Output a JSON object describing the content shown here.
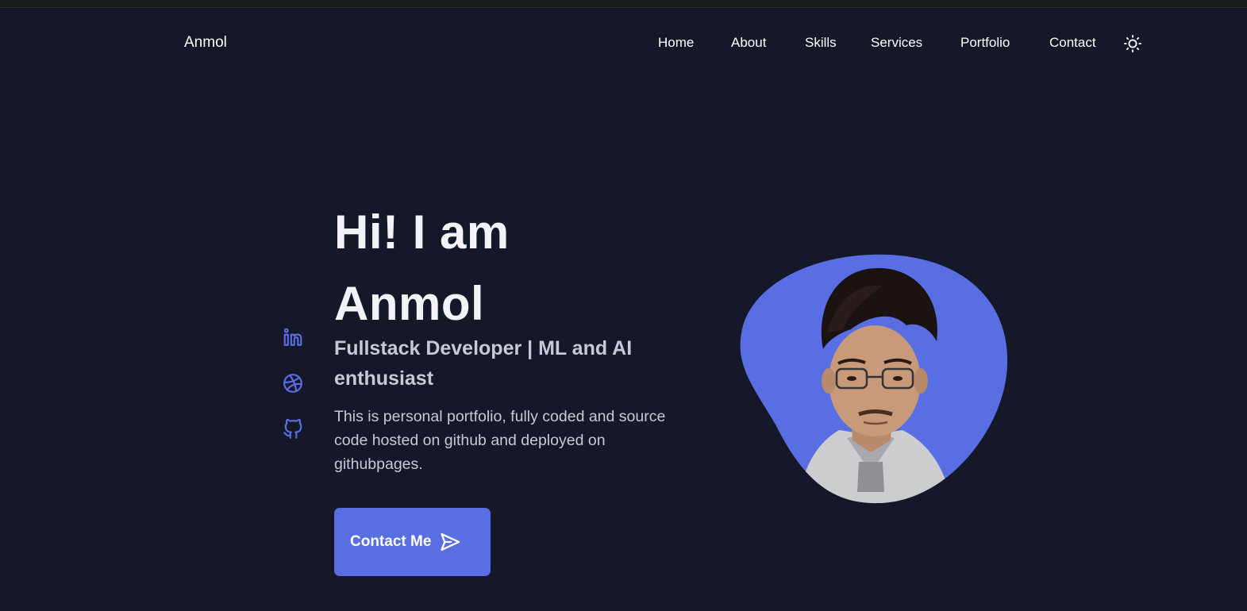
{
  "header": {
    "logo": "Anmol",
    "nav": [
      "Home",
      "About",
      "Skills",
      "Services",
      "Portfolio",
      "Contact"
    ],
    "theme_toggle_icon": "sun-icon"
  },
  "socials": [
    {
      "name": "linkedin",
      "icon": "linkedin-icon"
    },
    {
      "name": "dribbble",
      "icon": "dribbble-icon"
    },
    {
      "name": "github",
      "icon": "github-icon"
    }
  ],
  "hero": {
    "title_line1": "Hi! I am",
    "title_line2": "Anmol",
    "subtitle": "Fullstack Developer | ML and AI enthusiast",
    "description": "This is personal portfolio, fully coded and source code hosted on github and deployed on githubpages.",
    "cta_label": "Contact Me",
    "cta_icon": "send-icon"
  },
  "colors": {
    "background": "#151828",
    "accent": "#5a6ee3",
    "text": "#ffffff",
    "muted_text": "#c7c9d6"
  }
}
